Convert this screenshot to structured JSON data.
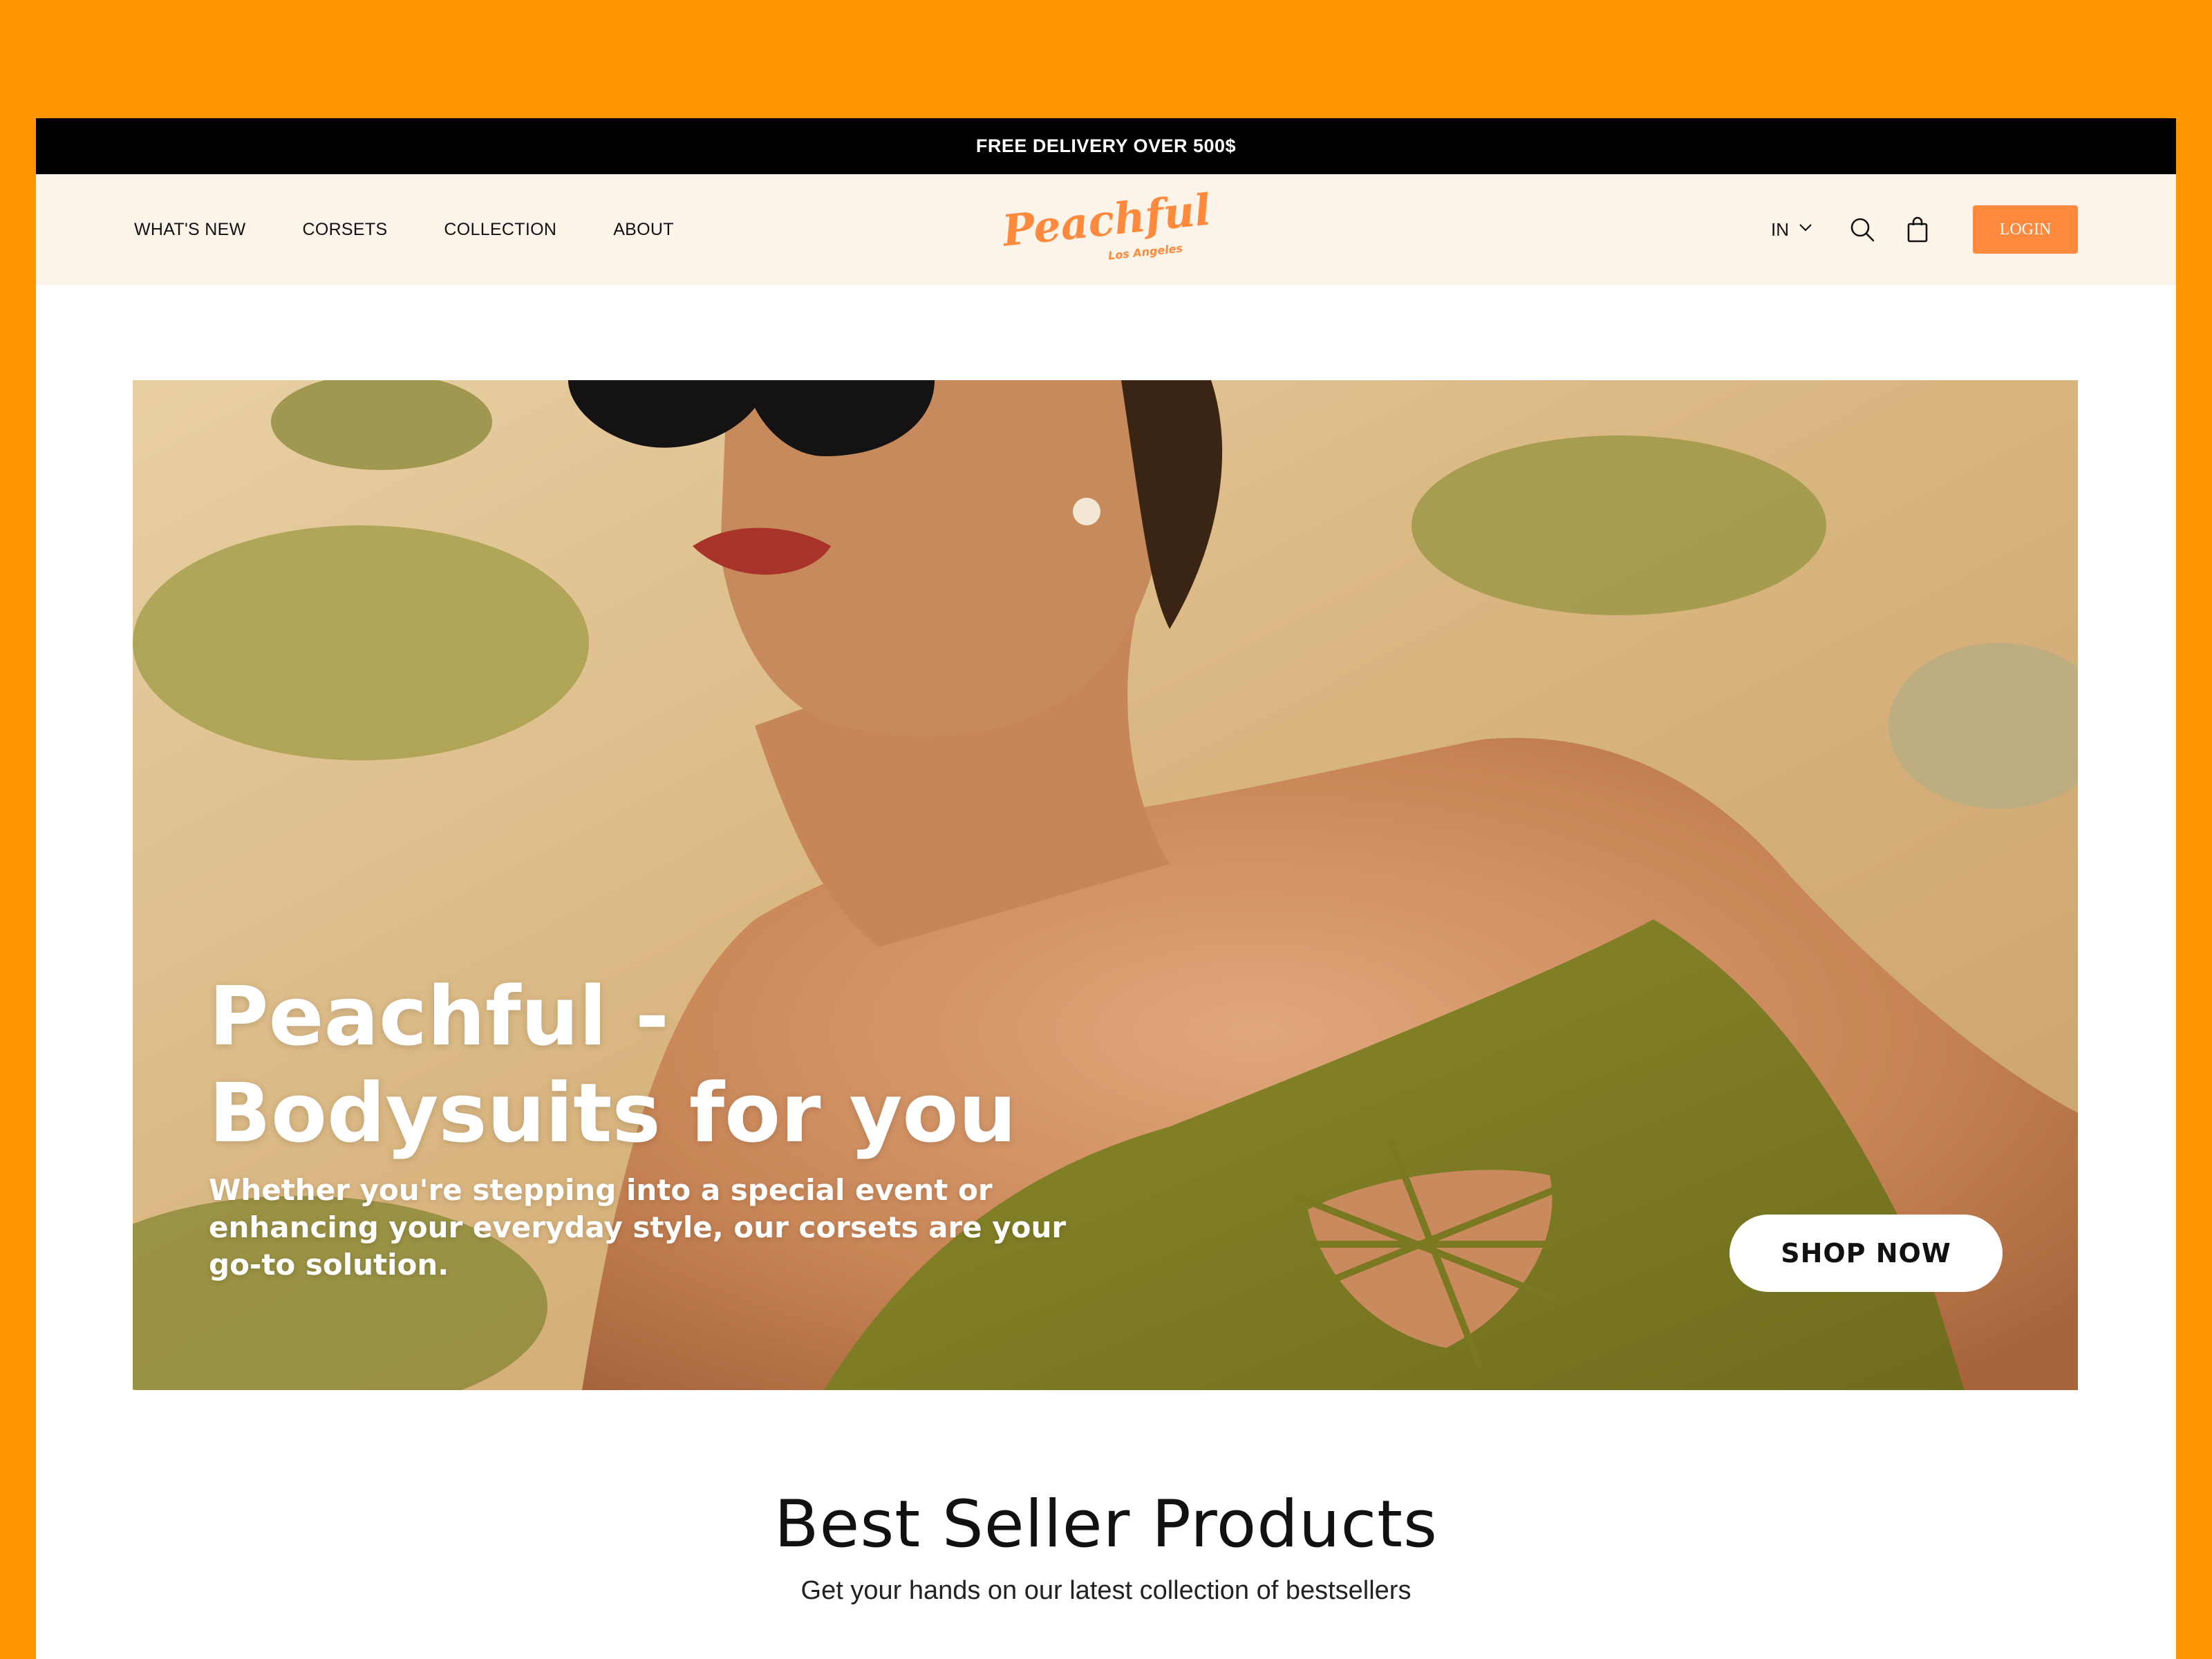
{
  "promo": {
    "text": "FREE DELIVERY OVER 500$"
  },
  "nav": {
    "links": [
      "WHAT'S NEW",
      "CORSETS",
      "COLLECTION",
      "ABOUT"
    ],
    "logo_text": "Peachful",
    "logo_sub": "Los Angeles",
    "language": "IN",
    "login_label": "LOGIN"
  },
  "icons": [
    "chevron-down-icon",
    "search-icon",
    "shopping-bag-icon"
  ],
  "hero": {
    "title_line1": "Peachful -",
    "title_line2": "Bodysuits for you",
    "subtitle": "Whether you're stepping into a special event or enhancing your everyday style, our corsets are your go-to solution.",
    "cta_label": "SHOP NOW"
  },
  "best_sellers": {
    "title": "Best Seller Products",
    "subtitle": "Get your hands on our latest collection of bestsellers"
  },
  "colors": {
    "background": "#ff9500",
    "accent": "#ff8a3d",
    "promo_bar": "#000000",
    "nav_bg": "#fdf4e9"
  }
}
